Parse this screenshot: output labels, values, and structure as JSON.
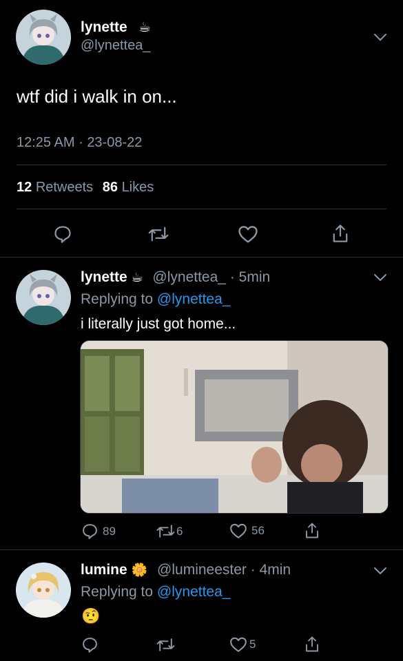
{
  "main_tweet": {
    "display_name": "lynette",
    "name_emoji": "☕",
    "handle": "@lynettea_",
    "text": "wtf did i walk in on...",
    "time": "12:25 AM",
    "separator": "·",
    "date": "23-08-22",
    "retweets_count": "12",
    "retweets_label": "Retweets",
    "likes_count": "86",
    "likes_label": "Likes"
  },
  "reply1": {
    "display_name": "lynette",
    "name_emoji": "☕",
    "handle": "@lynettea_",
    "time": "· 5min",
    "replying_prefix": "Replying to",
    "replying_handle": "@lynettea_",
    "text": "i literally just got home...",
    "reply_count": "89",
    "retweet_count": "6",
    "like_count": "56"
  },
  "reply2": {
    "display_name": "lumine",
    "name_emoji": "🌼",
    "handle": "@lumineester",
    "time": "· 4min",
    "replying_prefix": "Replying to",
    "replying_handle": "@lynettea_",
    "text": "🤨",
    "like_count": "5"
  },
  "icons": [
    "chevron-down-icon",
    "reply-icon",
    "retweet-icon",
    "like-icon",
    "share-icon"
  ],
  "colors": {
    "background": "#000000",
    "text": "#ffffff",
    "muted": "#8b98a5",
    "link": "#1d9bf0",
    "divider": "#2f3336"
  }
}
